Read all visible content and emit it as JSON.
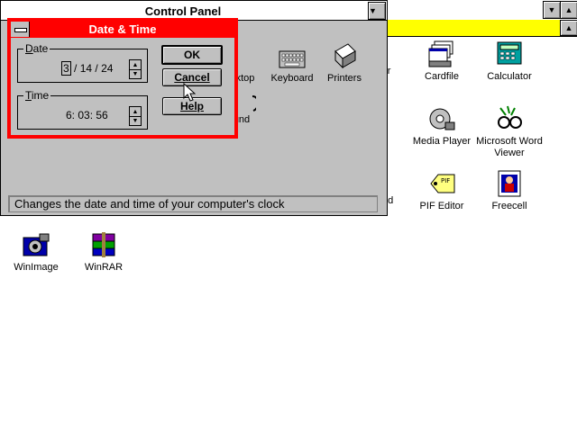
{
  "program_manager": {
    "icons": [
      {
        "label": "Cardfile",
        "icon": "cardfile-icon"
      },
      {
        "label": "Calculator",
        "icon": "calculator-icon"
      },
      {
        "label": "Media Player",
        "icon": "media-player-icon"
      },
      {
        "label": "Microsoft Word Viewer",
        "icon": "word-viewer-icon"
      },
      {
        "label": "PIF Editor",
        "icon": "pif-editor-icon"
      },
      {
        "label": "Freecell",
        "icon": "freecell-icon"
      },
      {
        "label": "WinImage",
        "icon": "winimage-icon"
      },
      {
        "label": "WinRAR",
        "icon": "winrar-icon"
      }
    ],
    "partial_labels": {
      "rer": "rer",
      "nd": "nd"
    }
  },
  "control_panel": {
    "title": "Control Panel",
    "icons": [
      {
        "label": "ktop"
      },
      {
        "label": "Keyboard"
      },
      {
        "label": "Printers"
      },
      {
        "label": "und"
      }
    ],
    "status": "Changes the date and time of your computer's clock"
  },
  "date_time_dialog": {
    "title": "Date & Time",
    "date_label_first": "D",
    "date_label_rest": "ate",
    "date_month": "3",
    "date_sep1": "/",
    "date_day": "14",
    "date_sep2": "/",
    "date_year": "24",
    "time_label_first": "T",
    "time_label_rest": "ime",
    "time_value": "6: 03: 56",
    "ok_label": "OK",
    "cancel_label": "Cancel",
    "help_label": "Help"
  },
  "colors": {
    "dialog_frame": "#ff0000",
    "yellow_bar": "#ffff00",
    "face": "#c0c0c0"
  }
}
